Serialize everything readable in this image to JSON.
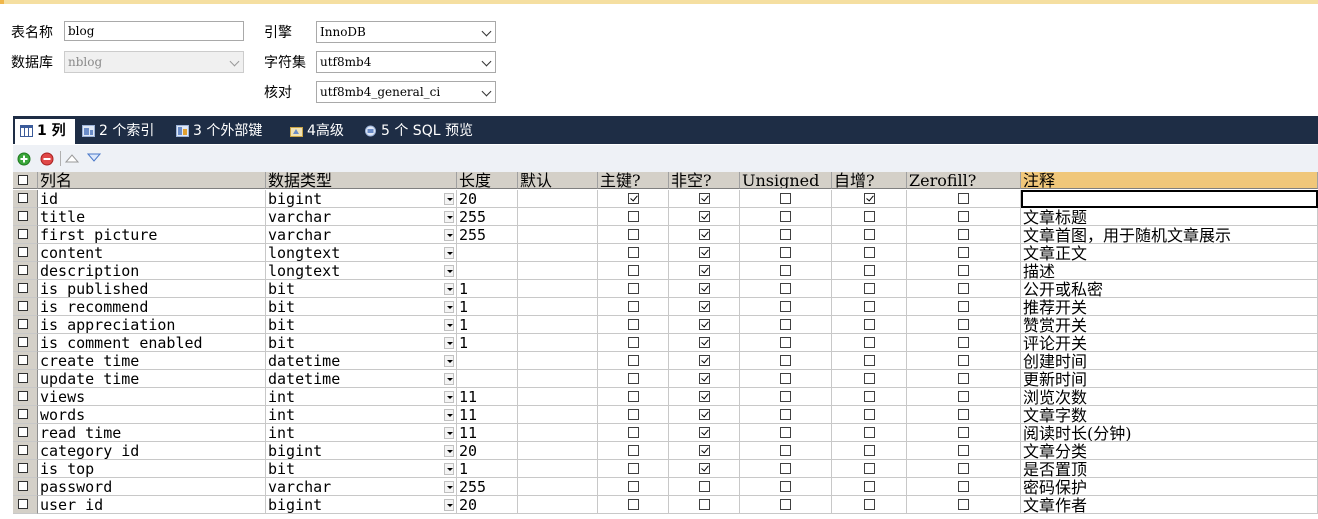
{
  "form": {
    "table_name_label": "表名称",
    "table_name_value": "blog",
    "database_label": "数据库",
    "database_value": "nblog",
    "engine_label": "引擎",
    "engine_value": "InnoDB",
    "charset_label": "字符集",
    "charset_value": "utf8mb4",
    "collation_label": "核对",
    "collation_value": "utf8mb4_general_ci"
  },
  "tabs": [
    {
      "label": "1 列",
      "active": true
    },
    {
      "label": "2 个索引",
      "active": false
    },
    {
      "label": "3 个外部键",
      "active": false
    },
    {
      "label": "4高级",
      "active": false
    },
    {
      "label": "5 个 SQL 预览",
      "active": false
    }
  ],
  "columns": {
    "headers": [
      "列名",
      "数据类型",
      "长度",
      "默认",
      "主键?",
      "非空?",
      "Unsigned",
      "自增?",
      "Zerofill?",
      "注释"
    ],
    "rows": [
      {
        "name": "id",
        "type": "bigint",
        "length": "20",
        "default": "",
        "pk": true,
        "notnull": true,
        "unsigned": false,
        "ai": true,
        "zerofill": false,
        "comment": ""
      },
      {
        "name": "title",
        "type": "varchar",
        "length": "255",
        "default": "",
        "pk": false,
        "notnull": true,
        "unsigned": false,
        "ai": false,
        "zerofill": false,
        "comment": "文章标题"
      },
      {
        "name": "first_picture",
        "type": "varchar",
        "length": "255",
        "default": "",
        "pk": false,
        "notnull": true,
        "unsigned": false,
        "ai": false,
        "zerofill": false,
        "comment": "文章首图，用于随机文章展示"
      },
      {
        "name": "content",
        "type": "longtext",
        "length": "",
        "default": "",
        "pk": false,
        "notnull": true,
        "unsigned": false,
        "ai": false,
        "zerofill": false,
        "comment": "文章正文"
      },
      {
        "name": "description",
        "type": "longtext",
        "length": "",
        "default": "",
        "pk": false,
        "notnull": true,
        "unsigned": false,
        "ai": false,
        "zerofill": false,
        "comment": "描述"
      },
      {
        "name": "is_published",
        "type": "bit",
        "length": "1",
        "default": "",
        "pk": false,
        "notnull": true,
        "unsigned": false,
        "ai": false,
        "zerofill": false,
        "comment": "公开或私密"
      },
      {
        "name": "is_recommend",
        "type": "bit",
        "length": "1",
        "default": "",
        "pk": false,
        "notnull": true,
        "unsigned": false,
        "ai": false,
        "zerofill": false,
        "comment": "推荐开关"
      },
      {
        "name": "is_appreciation",
        "type": "bit",
        "length": "1",
        "default": "",
        "pk": false,
        "notnull": true,
        "unsigned": false,
        "ai": false,
        "zerofill": false,
        "comment": "赞赏开关"
      },
      {
        "name": "is_comment_enabled",
        "type": "bit",
        "length": "1",
        "default": "",
        "pk": false,
        "notnull": true,
        "unsigned": false,
        "ai": false,
        "zerofill": false,
        "comment": "评论开关"
      },
      {
        "name": "create_time",
        "type": "datetime",
        "length": "",
        "default": "",
        "pk": false,
        "notnull": true,
        "unsigned": false,
        "ai": false,
        "zerofill": false,
        "comment": "创建时间"
      },
      {
        "name": "update_time",
        "type": "datetime",
        "length": "",
        "default": "",
        "pk": false,
        "notnull": true,
        "unsigned": false,
        "ai": false,
        "zerofill": false,
        "comment": "更新时间"
      },
      {
        "name": "views",
        "type": "int",
        "length": "11",
        "default": "",
        "pk": false,
        "notnull": true,
        "unsigned": false,
        "ai": false,
        "zerofill": false,
        "comment": "浏览次数"
      },
      {
        "name": "words",
        "type": "int",
        "length": "11",
        "default": "",
        "pk": false,
        "notnull": true,
        "unsigned": false,
        "ai": false,
        "zerofill": false,
        "comment": "文章字数"
      },
      {
        "name": "read_time",
        "type": "int",
        "length": "11",
        "default": "",
        "pk": false,
        "notnull": true,
        "unsigned": false,
        "ai": false,
        "zerofill": false,
        "comment": "阅读时长(分钟)"
      },
      {
        "name": "category_id",
        "type": "bigint",
        "length": "20",
        "default": "",
        "pk": false,
        "notnull": true,
        "unsigned": false,
        "ai": false,
        "zerofill": false,
        "comment": "文章分类"
      },
      {
        "name": "is_top",
        "type": "bit",
        "length": "1",
        "default": "",
        "pk": false,
        "notnull": true,
        "unsigned": false,
        "ai": false,
        "zerofill": false,
        "comment": "是否置顶"
      },
      {
        "name": "password",
        "type": "varchar",
        "length": "255",
        "default": "",
        "pk": false,
        "notnull": false,
        "unsigned": false,
        "ai": false,
        "zerofill": false,
        "comment": "密码保护"
      },
      {
        "name": "user_id",
        "type": "bigint",
        "length": "20",
        "default": "",
        "pk": false,
        "notnull": false,
        "unsigned": false,
        "ai": false,
        "zerofill": false,
        "comment": "文章作者"
      }
    ]
  },
  "colors": {
    "tabbar_bg": "#1e2d45",
    "header_bg": "#d4d0c8",
    "comment_header_bg": "#f0c77a",
    "toolbar_bg": "#eef1f6"
  },
  "icons": {
    "add": "add-column-icon",
    "remove": "remove-column-icon",
    "up": "move-up-icon",
    "down": "move-down-icon"
  }
}
